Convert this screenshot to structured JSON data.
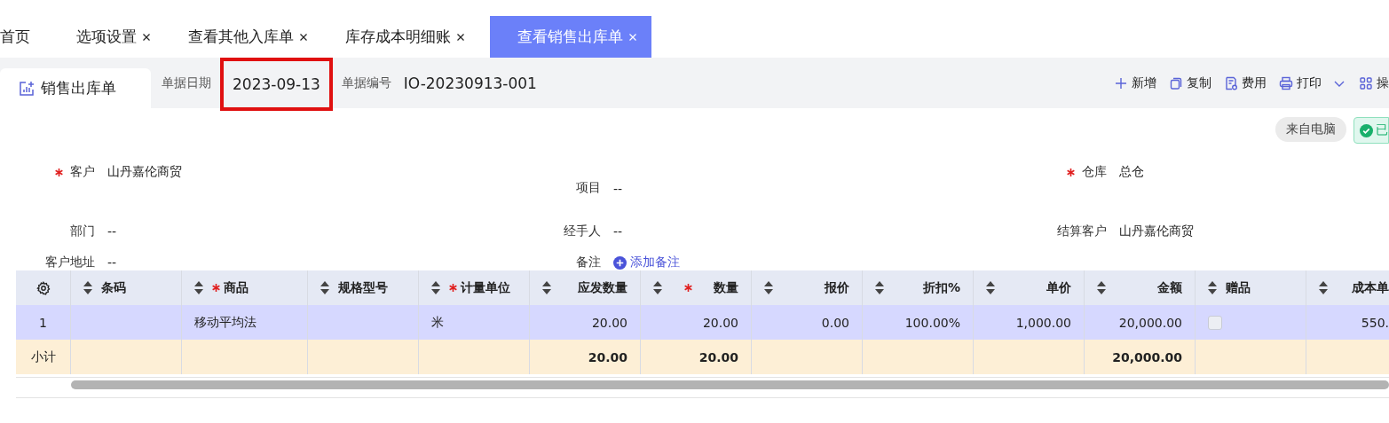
{
  "tabs": [
    {
      "label": "首页",
      "closable": false,
      "selected": false
    },
    {
      "label": "选项设置",
      "closable": true,
      "selected": false
    },
    {
      "label": "查看其他入库单",
      "closable": true,
      "selected": false
    },
    {
      "label": "库存成本明细账",
      "closable": true,
      "selected": false
    },
    {
      "label": "查看销售出库单",
      "closable": true,
      "selected": true
    }
  ],
  "doc": {
    "title": "销售出库单",
    "date_label": "单据日期",
    "date": "2023-09-13",
    "date_highlighted": true,
    "number_label": "单据编号",
    "number": "IO-20230913-001"
  },
  "actions": [
    {
      "label": "新增",
      "dropdown": false
    },
    {
      "label": "复制",
      "dropdown": false
    },
    {
      "label": "费用",
      "dropdown": false
    },
    {
      "label": "打印",
      "dropdown": true
    },
    {
      "label": "操",
      "dropdown": false
    }
  ],
  "badges": [
    {
      "label": "来自电脑",
      "kind": "source"
    },
    {
      "label": "已",
      "kind": "status"
    }
  ],
  "form": [
    [
      {
        "label": "客户",
        "value": "山丹嘉伦商贸",
        "required": true,
        "kind": "text"
      },
      {
        "label": "项目",
        "value": "--",
        "required": false,
        "kind": "text"
      },
      {
        "label": "仓库",
        "value": "总仓",
        "required": true,
        "kind": "text"
      }
    ],
    [
      {
        "label": "部门",
        "value": "--",
        "required": false,
        "kind": "text"
      },
      {
        "label": "经手人",
        "value": "--",
        "required": false,
        "kind": "text"
      },
      {
        "label": "结算客户",
        "value": "山丹嘉伦商贸",
        "required": false,
        "kind": "text"
      }
    ],
    [
      {
        "label": "客户地址",
        "value": "--",
        "required": false,
        "kind": "text"
      },
      {
        "label": "备注",
        "value": "添加备注",
        "required": false,
        "kind": "link"
      }
    ]
  ],
  "table": {
    "columns": [
      {
        "kind": "settings"
      },
      {
        "kind": "text",
        "label": "条码",
        "required": false
      },
      {
        "kind": "text",
        "label": "商品",
        "required": true
      },
      {
        "kind": "text",
        "label": "规格型号",
        "required": false
      },
      {
        "kind": "text",
        "label": "计量单位",
        "required": true
      },
      {
        "kind": "number",
        "label": "应发数量",
        "required": false
      },
      {
        "kind": "number",
        "label": "数量",
        "required": true
      },
      {
        "kind": "number",
        "label": "报价",
        "required": false
      },
      {
        "kind": "number",
        "label": "折扣%",
        "required": false
      },
      {
        "kind": "number",
        "label": "单价",
        "required": false
      },
      {
        "kind": "number",
        "label": "金额",
        "required": false
      },
      {
        "kind": "text",
        "label": "赠品",
        "required": false
      },
      {
        "kind": "number",
        "label": "成本单",
        "required": false
      }
    ],
    "rows": [
      {
        "selected": true,
        "cells": [
          "1",
          null,
          "移动平均法",
          null,
          "米",
          "20.00",
          "20.00",
          "0.00",
          "100.00%",
          "1,000.00",
          "20,000.00",
          {
            "kind": "checkbox",
            "checked": false
          },
          "550."
        ]
      }
    ],
    "subtotal": {
      "label": "小计",
      "due_quantity": "20.00",
      "quantity": "20.00",
      "amount": "20,000.00"
    }
  }
}
